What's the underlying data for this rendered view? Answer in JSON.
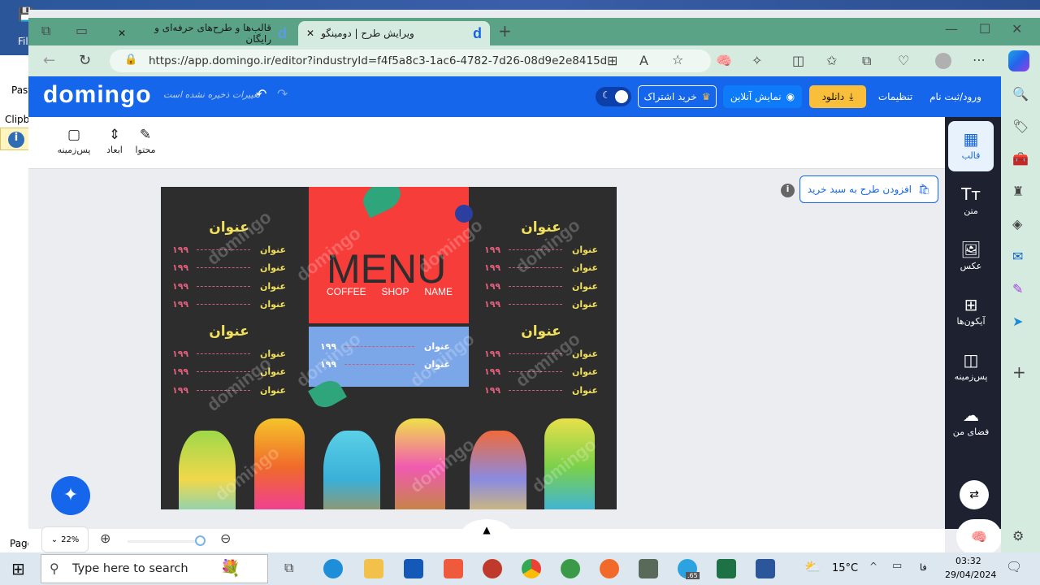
{
  "word": {
    "file": "File",
    "paste": "Paste",
    "clipboard": "Clipbo",
    "page": "Page"
  },
  "browser": {
    "tabs": [
      {
        "title": "قالب‌ها و طرح‌های حرفه‌ای و رایگان"
      },
      {
        "title": "ویرایش طرح | دومینگو",
        "active": true
      }
    ],
    "url": "https://app.domingo.ir/editor?industryId=f4f5a8c3-1ac6-4782-7d26-08d9e2e8415d"
  },
  "header": {
    "logo": "domingo",
    "unsaved": "تغییرات ذخیره نشده است",
    "login": "ورود/ثبت نام",
    "settings": "تنظیمات",
    "download": "دانلود",
    "preview": "نمایش آنلاین",
    "subscribe": "خرید اشتراک"
  },
  "toolbar": {
    "items": [
      {
        "label": "محتوا",
        "icon": "✎"
      },
      {
        "label": "ابعاد",
        "icon": "⇕"
      },
      {
        "label": "پس‌زمینه",
        "icon": "▢"
      }
    ]
  },
  "sidebar": {
    "items": [
      {
        "label": "قالب",
        "icon": "▦",
        "active": true
      },
      {
        "label": "متن",
        "icon": "Tт"
      },
      {
        "label": "عکس",
        "icon": "🖼"
      },
      {
        "label": "آیکون‌ها",
        "icon": "⊞"
      },
      {
        "label": "پس‌زمینه",
        "icon": "◫"
      },
      {
        "label": "فضای من",
        "icon": "☁"
      }
    ]
  },
  "cart": {
    "label": "افزودن طرح به سبد خرید"
  },
  "design": {
    "title": "MENU",
    "subtitle": [
      "COFFEE",
      "SHOP",
      "NAME"
    ],
    "watermark": "domingo",
    "sections": [
      {
        "title": "عنوان",
        "items": [
          {
            "name": "عنوان",
            "price": "۱۹۹"
          },
          {
            "name": "عنوان",
            "price": "۱۹۹"
          },
          {
            "name": "عنوان",
            "price": "۱۹۹"
          },
          {
            "name": "عنوان",
            "price": "۱۹۹"
          }
        ]
      },
      {
        "title": "عنوان",
        "items": [
          {
            "name": "عنوان",
            "price": "۱۹۹"
          },
          {
            "name": "عنوان",
            "price": "۱۹۹"
          },
          {
            "name": "عنوان",
            "price": "۱۹۹"
          }
        ]
      },
      {
        "title": "عنوان",
        "items": [
          {
            "name": "عنوان",
            "price": "۱۹۹"
          },
          {
            "name": "عنوان",
            "price": "۱۹۹"
          },
          {
            "name": "عنوان",
            "price": "۱۹۹"
          },
          {
            "name": "عنوان",
            "price": "۱۹۹"
          }
        ]
      },
      {
        "title": "عنوان",
        "items": [
          {
            "name": "عنوان",
            "price": "۱۹۹"
          },
          {
            "name": "عنوان",
            "price": "۱۹۹"
          },
          {
            "name": "عنوان",
            "price": "۱۹۹"
          }
        ]
      },
      {
        "title": "",
        "items": [
          {
            "name": "عنوان",
            "price": "۱۹۹"
          },
          {
            "name": "عنوان",
            "price": "۱۹۹"
          }
        ]
      }
    ]
  },
  "zoom": {
    "value": "22%",
    "level": 1.0
  },
  "taskbar": {
    "search_placeholder": "Type here to search",
    "weather": "15°C",
    "lang": "فا",
    "time": "03:32",
    "date": "29/04/2024",
    "telegram_badge": ".65"
  },
  "colors": {
    "brand": "#1566ea",
    "download": "#f9bf3b",
    "sidebar": "#1d2130",
    "menu_red": "#f63d3a",
    "menu_blue": "#7ba6e8"
  }
}
